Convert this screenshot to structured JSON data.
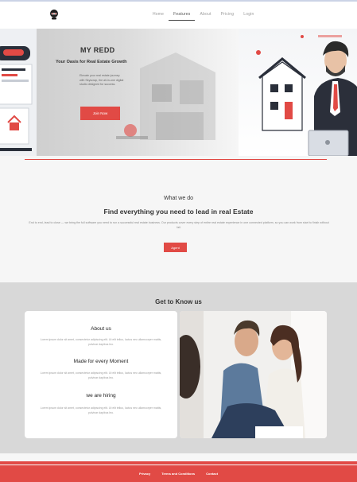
{
  "header": {
    "nav": [
      "Home",
      "Features",
      "About",
      "Pricing",
      "Login"
    ],
    "active_nav": "Features"
  },
  "hero": {
    "title": "MY REDD",
    "subtitle": "Your Oasis for Real Estate Growth",
    "description": "Elevate your real estate journey with Skyscrap, the all-in-one digital studio designed for success.",
    "button": "Join Now"
  },
  "what_we_do": {
    "label": "What we do",
    "title": "Find everything you need to lead in real Estate",
    "description": "End to end, lead to close — we bring the full software you need to run a successful real estate business. Our products cover every step of entire real estate experience in one connected platform, so you can work from start to finish without fail.",
    "button": "Agent"
  },
  "know_us": {
    "title": "Get to Know us",
    "sections": [
      {
        "heading": "About us",
        "text": "Lorem ipsum dolor sit amet, consectetur adipiscing elit. Ut elit tellus, luctus nec ullamcorper mattis, pulvinar dapibus leo."
      },
      {
        "heading": "Made for every Moment",
        "text": "Lorem ipsum dolor sit amet, consectetur adipiscing elit. Ut elit tellus, luctus nec ullamcorper mattis, pulvinar dapibus leo."
      },
      {
        "heading": "we are hiring",
        "text": "Lorem ipsum dolor sit amet, consectetur adipiscing elit. Ut elit tellus, luctus nec ullamcorper mattis, pulvinar dapibus leo."
      }
    ]
  },
  "footer": {
    "links": [
      "Privacy",
      "Terms and Conditions",
      "Contact"
    ]
  },
  "colors": {
    "accent": "#e14a45",
    "background": "#f6f6f6",
    "section_gray": "#d8d8d8"
  },
  "icons": [
    "logo-robot-icon"
  ]
}
